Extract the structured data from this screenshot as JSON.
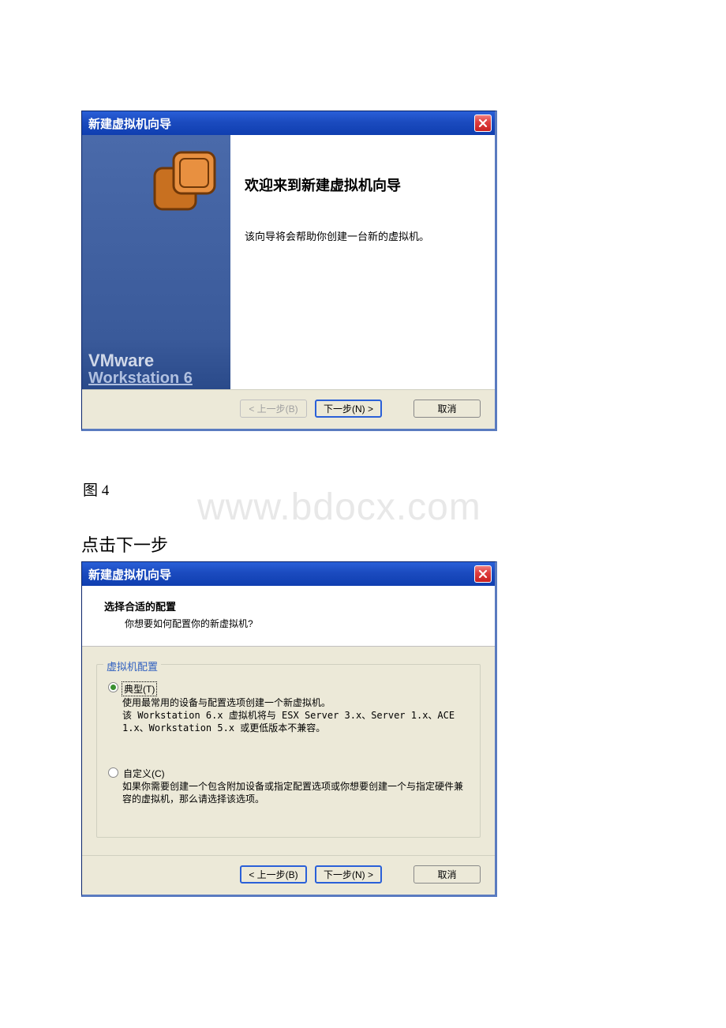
{
  "dialog1": {
    "title": "新建虚拟机向导",
    "welcome_heading": "欢迎来到新建虚拟机向导",
    "welcome_desc": "该向导将会帮助你创建一台新的虚拟机。",
    "sidebar_brand": "VMware",
    "sidebar_product": "Workstation 6",
    "btn_back": "< 上一步(B)",
    "btn_next": "下一步(N) >",
    "btn_cancel": "取消"
  },
  "figure_label": "图 4",
  "instruction_text": "点击下一步",
  "watermark_text": "www.bdocx.com",
  "dialog2": {
    "title": "新建虚拟机向导",
    "heading": "选择合适的配置",
    "subheading": "你想要如何配置你的新虚拟机?",
    "fieldset_legend": "虚拟机配置",
    "option_typical_label": "典型(T)",
    "option_typical_desc1": "使用最常用的设备与配置选项创建一个新虚拟机。",
    "option_typical_desc2": "该 Workstation 6.x 虚拟机将与 ESX Server 3.x、Server 1.x、ACE 1.x、Workstation 5.x 或更低版本不兼容。",
    "option_custom_label": "自定义(C)",
    "option_custom_desc": "如果你需要创建一个包含附加设备或指定配置选项或你想要创建一个与指定硬件兼容的虚拟机，那么请选择该选项。",
    "btn_back": "< 上一步(B)",
    "btn_next": "下一步(N) >",
    "btn_cancel": "取消"
  }
}
